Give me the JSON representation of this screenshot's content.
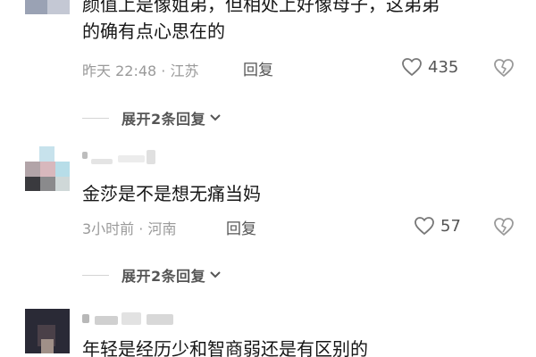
{
  "comments": [
    {
      "text_lines": [
        "颜值上是像姐弟，但相处上好像母子，这弟弟",
        "的确有点心思在的"
      ],
      "meta": "昨天 22:48 · 江苏",
      "reply": "回复",
      "likes": "435",
      "expand": "展开2条回复"
    },
    {
      "text_lines": [
        "金莎是不是想无痛当妈"
      ],
      "meta": "3小时前 · 河南",
      "reply": "回复",
      "likes": "57",
      "expand": "展开2条回复"
    },
    {
      "text_lines": [
        "年轻是经历少和智商弱还是有区别的"
      ]
    }
  ],
  "icons": {
    "like": "heart-outline-icon",
    "dislike": "broken-heart-icon",
    "expand": "chevron-down-icon"
  },
  "colors": {
    "text": "#161616",
    "meta": "#9a9a9a",
    "action": "#555555",
    "divider": "#d4d4d4"
  }
}
